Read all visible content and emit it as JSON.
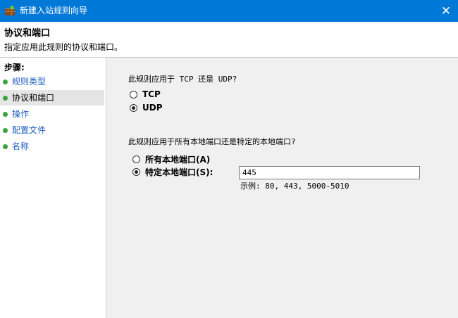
{
  "window": {
    "title": "新建入站规则向导",
    "close_glyph": "✕",
    "icon": "firewall-icon"
  },
  "header": {
    "title": "协议和端口",
    "subtitle": "指定应用此规则的协议和端口。"
  },
  "sidebar": {
    "steps_title": "步骤:",
    "items": [
      {
        "label": "规则类型",
        "active": false
      },
      {
        "label": "协议和端口",
        "active": true
      },
      {
        "label": "操作",
        "active": false
      },
      {
        "label": "配置文件",
        "active": false
      },
      {
        "label": "名称",
        "active": false
      }
    ]
  },
  "main": {
    "protocol_question": "此规则应用于 TCP 还是 UDP?",
    "protocol_options": [
      {
        "label": "TCP",
        "checked": false
      },
      {
        "label": "UDP",
        "checked": true
      }
    ],
    "port_question": "此规则应用于所有本地端口还是特定的本地端口?",
    "port_options": [
      {
        "label": "所有本地端口(A)",
        "checked": false
      },
      {
        "label": "特定本地端口(S):",
        "checked": true
      }
    ],
    "port_value": "445",
    "port_example": "示例: 80, 443, 5000-5010"
  },
  "colors": {
    "titlebar": "#0078d7",
    "step_dot": "#3aa23a",
    "link": "#1f5fbf"
  }
}
